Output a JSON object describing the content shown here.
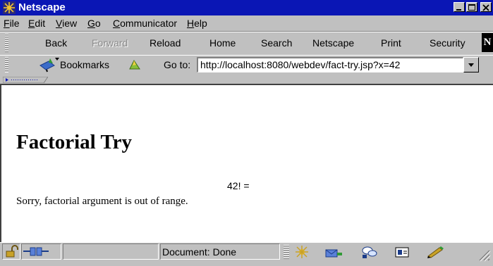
{
  "window": {
    "title": "Netscape"
  },
  "menu": [
    {
      "key": "F",
      "rest": "ile"
    },
    {
      "key": "E",
      "rest": "dit"
    },
    {
      "key": "V",
      "rest": "iew"
    },
    {
      "key": "G",
      "rest": "o"
    },
    {
      "key": "C",
      "rest": "ommunicator"
    },
    {
      "key": "H",
      "rest": "elp"
    }
  ],
  "toolbar": {
    "back": "Back",
    "forward": "Forward",
    "reload": "Reload",
    "home": "Home",
    "search": "Search",
    "netscape": "Netscape",
    "print": "Print",
    "security": "Security",
    "logo_letter": "N"
  },
  "location": {
    "bookmarks_label": "Bookmarks",
    "goto_label": "Go to:",
    "url": "http://localhost:8080/webdev/fact-try.jsp?x=42"
  },
  "content": {
    "heading": "Factorial Try",
    "factorial_line": "42! =",
    "error_message": "Sorry, factorial argument is out of range."
  },
  "status": {
    "text": "Document: Done"
  },
  "colors": {
    "title_bar": "#0a16b5",
    "chrome": "#c0c0c0",
    "page_bg": "#ffffff"
  }
}
